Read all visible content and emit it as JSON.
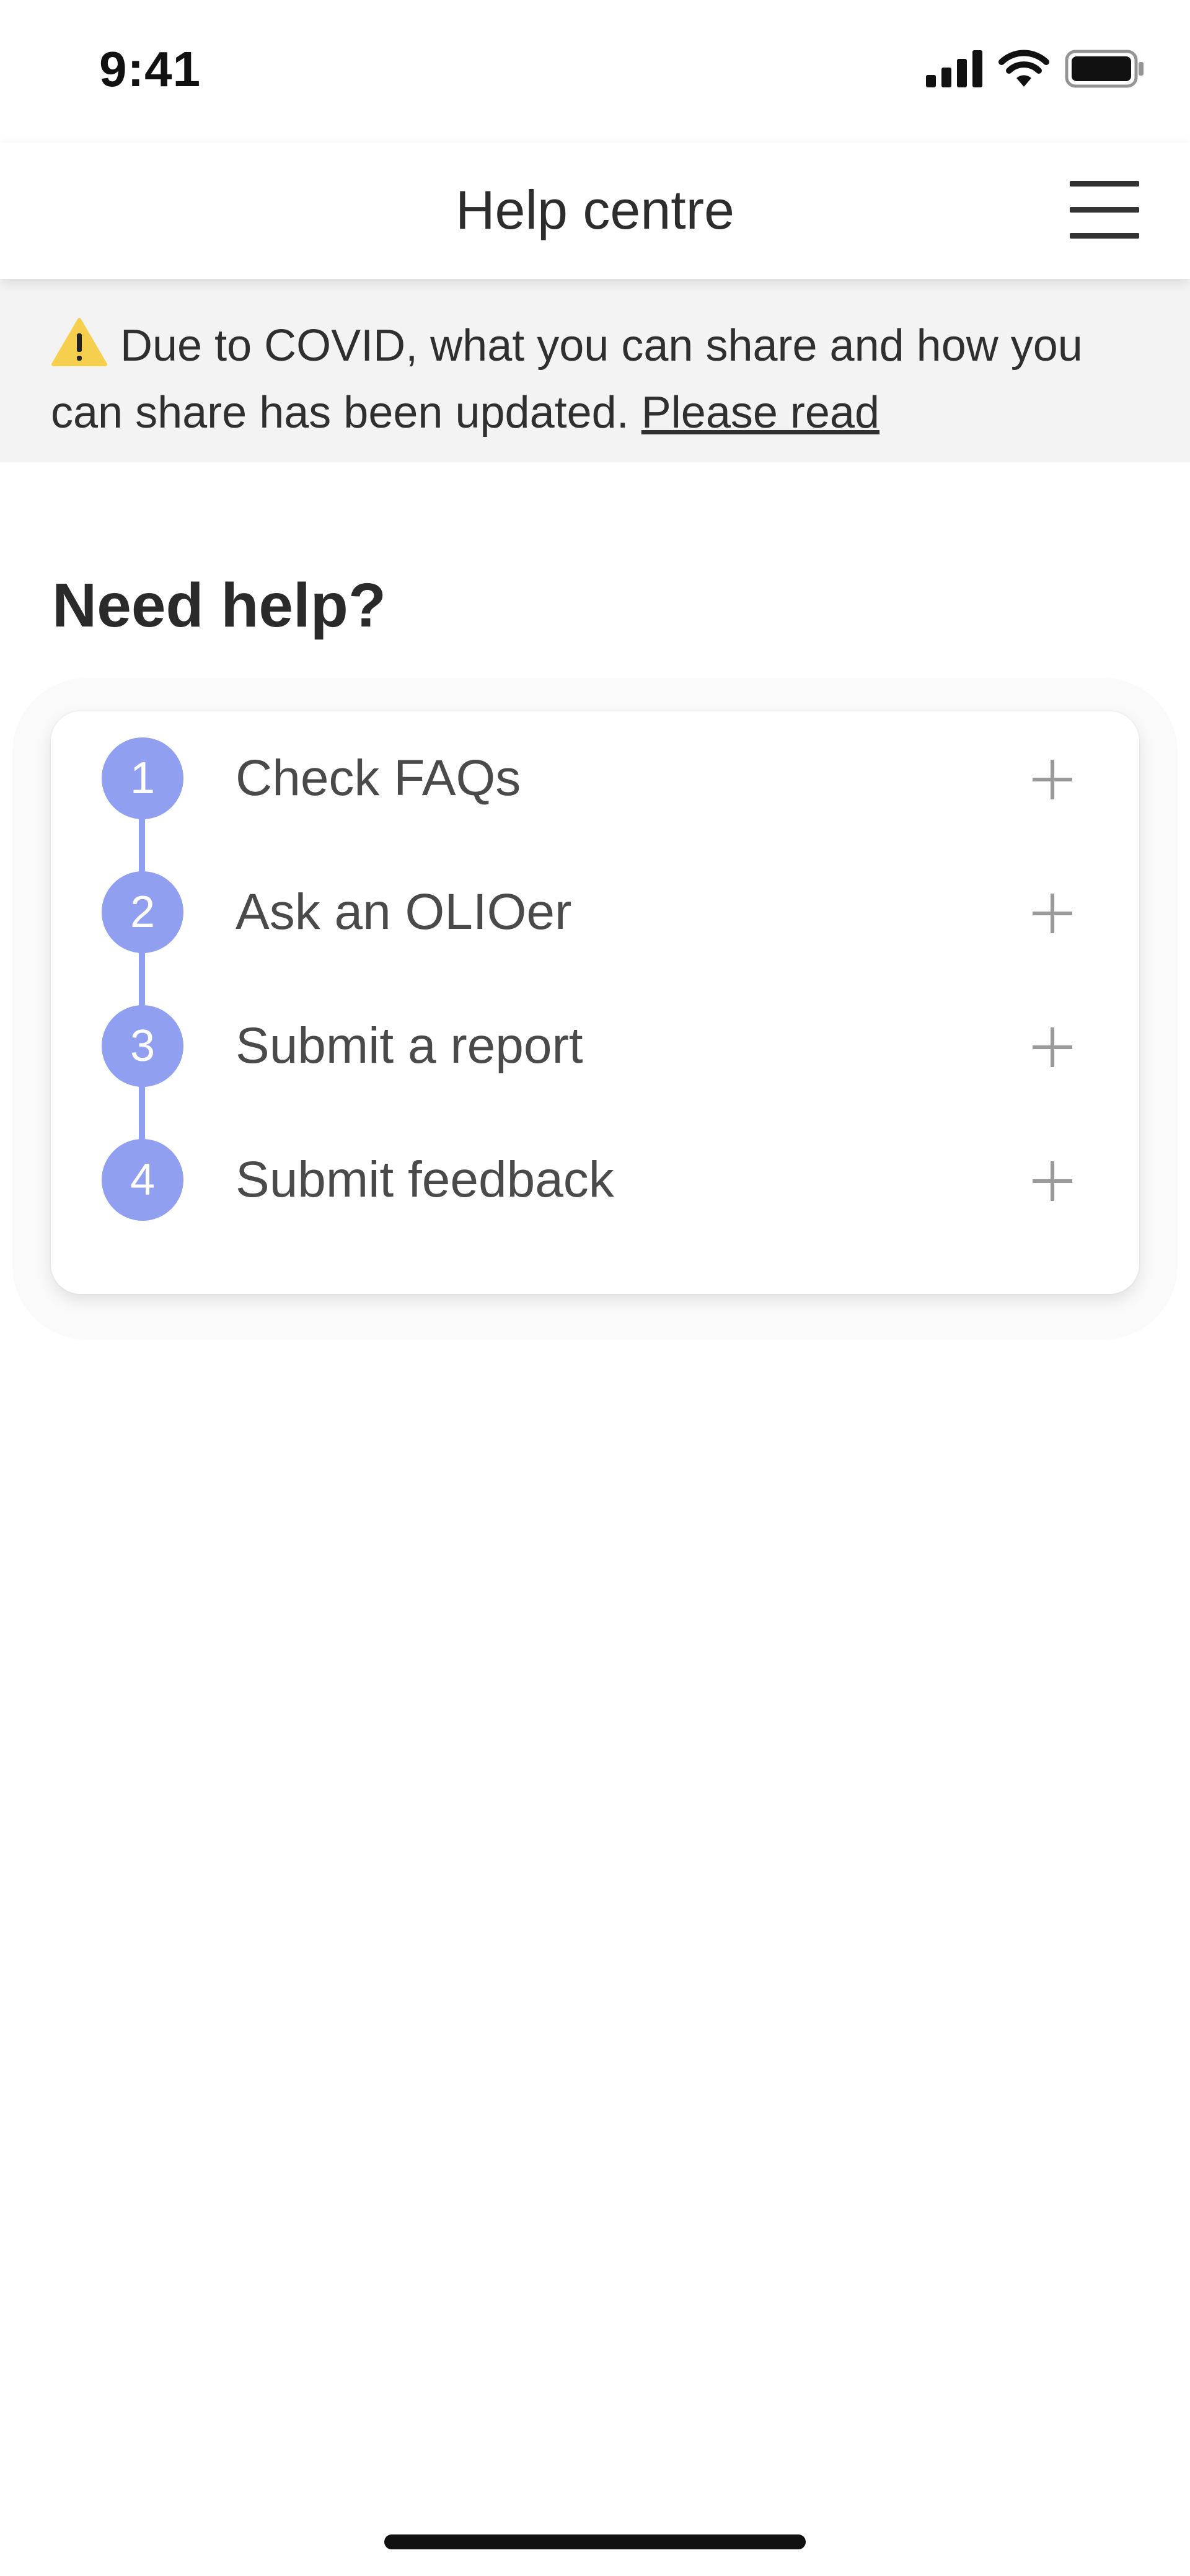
{
  "status_bar": {
    "time": "9:41"
  },
  "header": {
    "title": "Help centre"
  },
  "notice": {
    "text": "Due to COVID, what you can share and how you can share has been updated.",
    "link_label": "Please read"
  },
  "section": {
    "title": "Need help?"
  },
  "steps": [
    {
      "number": "1",
      "label": "Check FAQs"
    },
    {
      "number": "2",
      "label": "Ask an OLIOer"
    },
    {
      "number": "3",
      "label": "Submit a report"
    },
    {
      "number": "4",
      "label": "Submit feedback"
    }
  ],
  "icons": {
    "signal": "signal-icon",
    "wifi": "wifi-icon",
    "battery": "battery-icon",
    "menu": "hamburger-menu-icon",
    "warning": "warning-icon",
    "expand": "plus-icon"
  },
  "colors": {
    "accent": "#919ff0",
    "banner_background": "#f3f3f3",
    "warning": "#f5cf4d",
    "text": "#333333"
  }
}
